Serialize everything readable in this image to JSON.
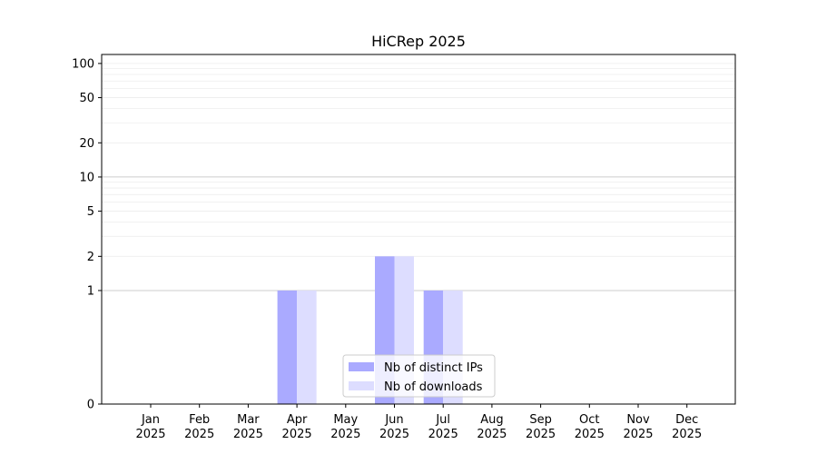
{
  "chart_data": {
    "type": "bar",
    "title": "HiCRep 2025",
    "xlabel": "",
    "ylabel": "",
    "yscale": "symlog",
    "ylim": [
      0,
      120
    ],
    "yticks": [
      0,
      1,
      2,
      5,
      10,
      20,
      50,
      100
    ],
    "categories": [
      [
        "Jan",
        "2025"
      ],
      [
        "Feb",
        "2025"
      ],
      [
        "Mar",
        "2025"
      ],
      [
        "Apr",
        "2025"
      ],
      [
        "May",
        "2025"
      ],
      [
        "Jun",
        "2025"
      ],
      [
        "Jul",
        "2025"
      ],
      [
        "Aug",
        "2025"
      ],
      [
        "Sep",
        "2025"
      ],
      [
        "Oct",
        "2025"
      ],
      [
        "Nov",
        "2025"
      ],
      [
        "Dec",
        "2025"
      ]
    ],
    "series": [
      {
        "name": "Nb of distinct IPs",
        "color": "#aaaaff",
        "values": [
          0,
          0,
          0,
          1,
          0,
          2,
          1,
          0,
          0,
          0,
          0,
          0
        ]
      },
      {
        "name": "Nb of downloads",
        "color": "#ddddff",
        "values": [
          0,
          0,
          0,
          1,
          0,
          2,
          1,
          0,
          0,
          0,
          0,
          0
        ]
      }
    ],
    "grid": true,
    "legend_position": "lower center"
  }
}
